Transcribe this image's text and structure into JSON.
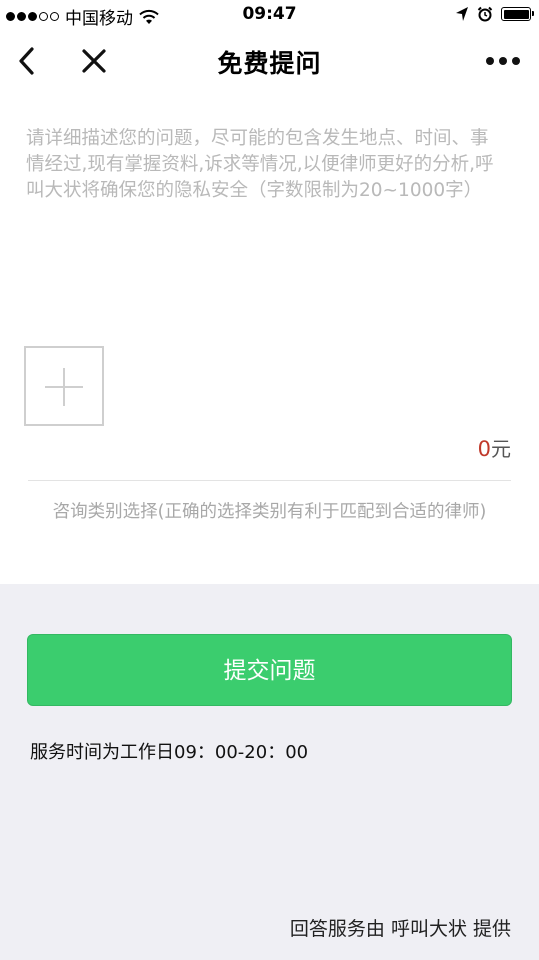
{
  "status_bar": {
    "carrier": "中国移动",
    "time": "09:47",
    "icons": [
      "signal-dots-icon",
      "wifi-icon",
      "location-arrow-icon",
      "alarm-icon",
      "battery-icon"
    ]
  },
  "nav": {
    "title": "免费提问",
    "back_icon": "chevron-left-icon",
    "close_icon": "close-icon",
    "more_icon": "more-dots-icon"
  },
  "form": {
    "question_placeholder": "请详细描述您的问题，尽可能的包含发生地点、时间、事情经过,现有掌握资料,诉求等情况,以便律师更好的分析,呼叫大状将确保您的隐私安全（字数限制为20~1000字）",
    "add_image_icon": "plus-icon",
    "price_amount": "0",
    "price_unit": "元",
    "category_prompt": "咨询类别选择(正确的选择类别有利于匹配到合适的律师)"
  },
  "actions": {
    "submit_label": "提交问题"
  },
  "footer": {
    "service_hours": "服务时间为工作日09：00-20：00",
    "provider": "回答服务由 呼叫大状 提供"
  },
  "colors": {
    "accent_green": "#3bcd6e",
    "price_red": "#c0392b",
    "page_background": "#efeff4"
  }
}
